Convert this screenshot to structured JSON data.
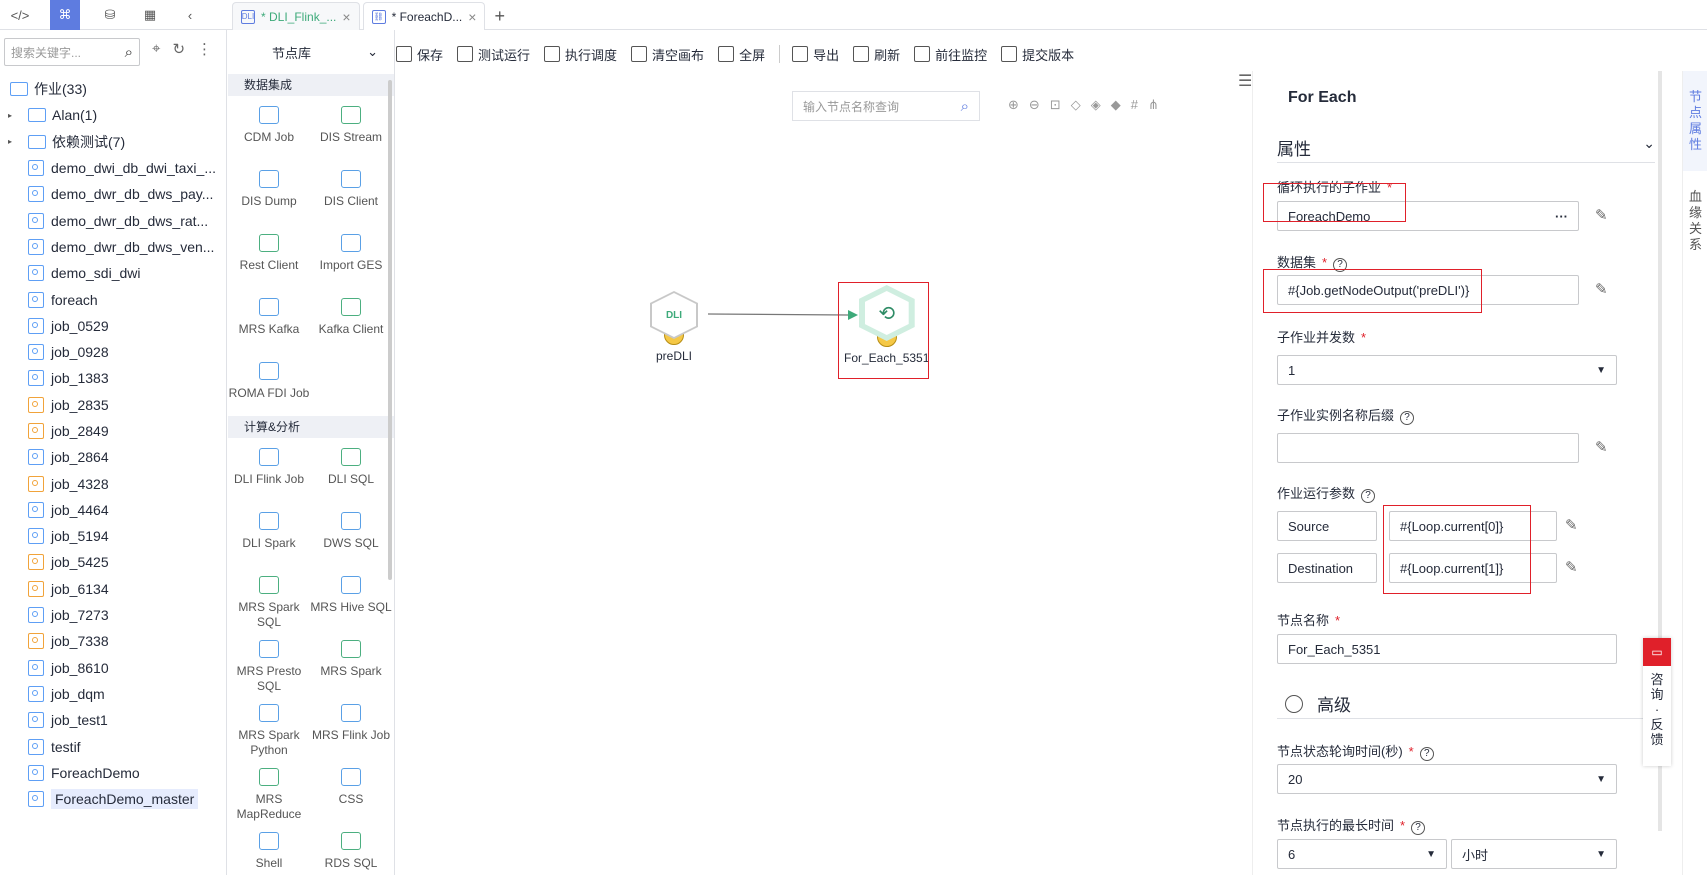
{
  "tabs": [
    {
      "label": "* DLI_Flink_...",
      "icon": "dli-icon"
    },
    {
      "label": "* ForeachD...",
      "icon": "job-icon"
    }
  ],
  "left": {
    "search_placeholder": "搜索关键字...",
    "root": "作业(33)",
    "folders": [
      "Alan(1)",
      "依赖测试(7)"
    ],
    "jobs": [
      {
        "name": "demo_dwi_db_dwi_taxi_...",
        "color": "blue"
      },
      {
        "name": "demo_dwr_db_dws_pay...",
        "color": "blue"
      },
      {
        "name": "demo_dwr_db_dws_rat...",
        "color": "blue"
      },
      {
        "name": "demo_dwr_db_dws_ven...",
        "color": "blue"
      },
      {
        "name": "demo_sdi_dwi",
        "color": "blue"
      },
      {
        "name": "foreach",
        "color": "blue"
      },
      {
        "name": "job_0529",
        "color": "blue"
      },
      {
        "name": "job_0928",
        "color": "blue"
      },
      {
        "name": "job_1383",
        "color": "blue"
      },
      {
        "name": "job_2835",
        "color": "yellow"
      },
      {
        "name": "job_2849",
        "color": "yellow"
      },
      {
        "name": "job_2864",
        "color": "blue"
      },
      {
        "name": "job_4328",
        "color": "yellow"
      },
      {
        "name": "job_4464",
        "color": "blue"
      },
      {
        "name": "job_5194",
        "color": "blue"
      },
      {
        "name": "job_5425",
        "color": "yellow"
      },
      {
        "name": "job_6134",
        "color": "yellow"
      },
      {
        "name": "job_7273",
        "color": "blue"
      },
      {
        "name": "job_7338",
        "color": "yellow"
      },
      {
        "name": "job_8610",
        "color": "blue"
      },
      {
        "name": "job_dqm",
        "color": "blue"
      },
      {
        "name": "job_test1",
        "color": "blue"
      },
      {
        "name": "testif",
        "color": "blue"
      },
      {
        "name": "ForeachDemo",
        "color": "blue"
      },
      {
        "name": "ForeachDemo_master",
        "color": "blue"
      }
    ]
  },
  "lib": {
    "title": "节点库",
    "sec1": "数据集成",
    "items1": [
      "CDM Job",
      "DIS Stream",
      "DIS Dump",
      "DIS Client",
      "Rest Client",
      "Import GES",
      "MRS Kafka",
      "Kafka Client",
      "ROMA FDI Job"
    ],
    "sec2": "计算&分析",
    "items2": [
      "DLI Flink Job",
      "DLI SQL",
      "DLI Spark",
      "DWS SQL",
      "MRS Spark SQL",
      "MRS Hive SQL",
      "MRS Presto SQL",
      "MRS Spark",
      "MRS Spark Python",
      "MRS Flink Job",
      "MRS MapReduce",
      "CSS",
      "Shell",
      "RDS SQL"
    ]
  },
  "toolbar": [
    "保存",
    "测试运行",
    "执行调度",
    "清空画布",
    "全屏",
    "导出",
    "刷新",
    "前往监控",
    "提交版本"
  ],
  "canvas": {
    "search_placeholder": "输入节点名称查询",
    "node1": "preDLI",
    "node2": "For_Each_5351",
    "dli_text": "DLI"
  },
  "props": {
    "title": "For Each",
    "section": "属性",
    "f1_label": "循环执行的子作业",
    "f1_value": "ForeachDemo",
    "f2_label": "数据集",
    "f2_value": "#{Job.getNodeOutput('preDLI')}",
    "f3_label": "子作业并发数",
    "f3_value": "1",
    "f4_label": "子作业实例名称后缀",
    "f4_value": "",
    "f5_label": "作业运行参数",
    "p1_key": "Source",
    "p1_val": "#{Loop.current[0]}",
    "p2_key": "Destination",
    "p2_val": "#{Loop.current[1]}",
    "f6_label": "节点名称",
    "f6_value": "For_Each_5351",
    "adv": "高级",
    "f7_label": "节点状态轮询时间(秒)",
    "f7_value": "20",
    "f8_label": "节点执行的最长时间",
    "f8_value": "6",
    "f8_unit": "小时"
  },
  "righttabs": [
    "节点属性",
    "血缘关系"
  ],
  "feedback": "咨询·反馈",
  "colors": {
    "accent": "#5e7ce0",
    "red": "#e0202a"
  }
}
